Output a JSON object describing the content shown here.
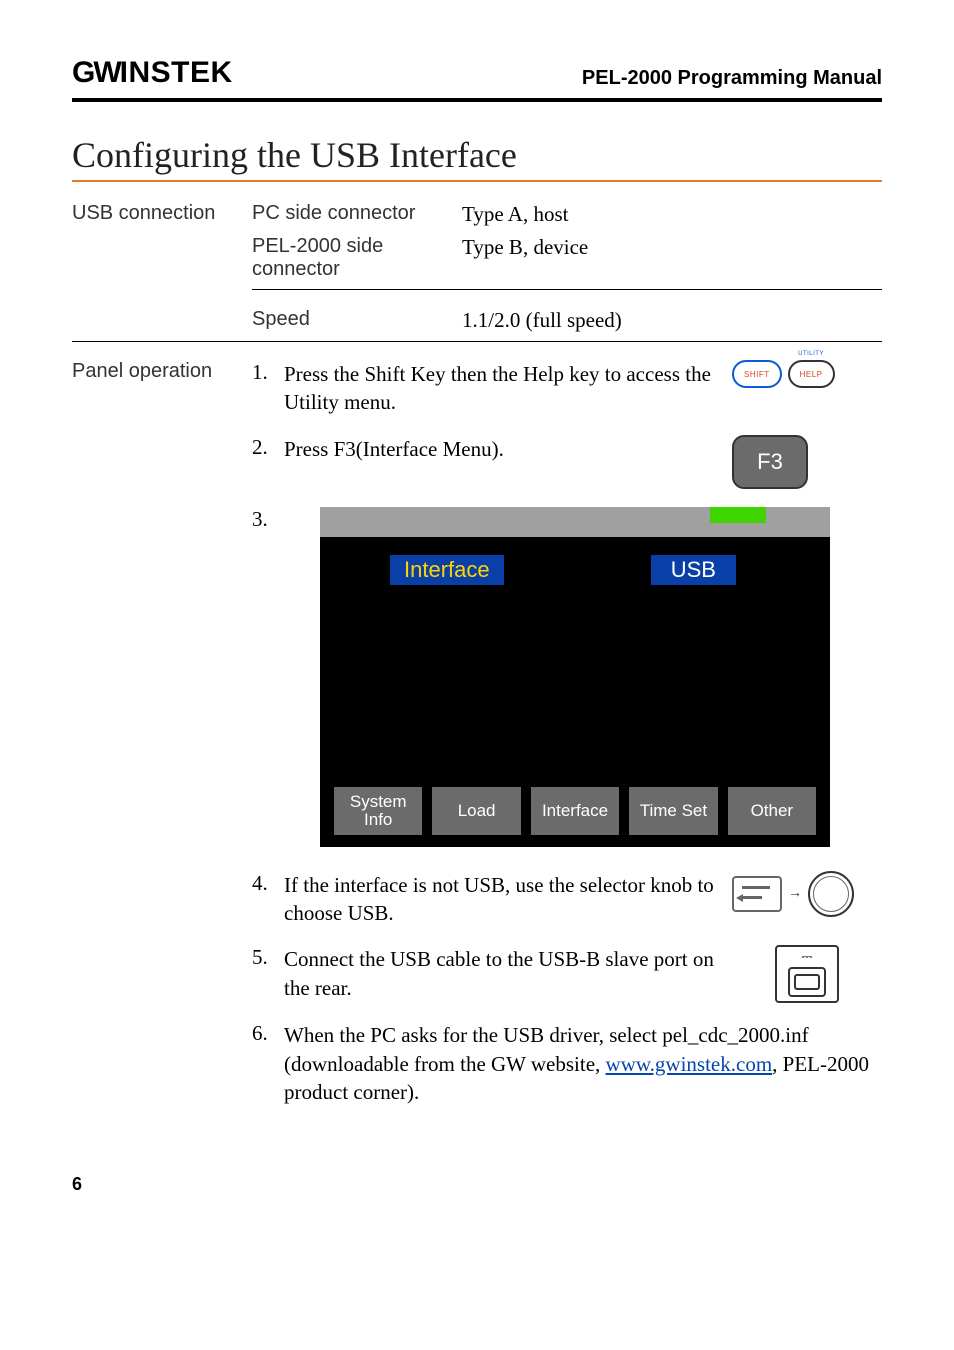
{
  "header": {
    "brand": "GWINSTEK",
    "doc_title": "PEL-2000 Programming Manual"
  },
  "section_title": "Configuring the USB Interface",
  "usb_connection": {
    "label": "USB connection",
    "rows": [
      {
        "a": "PC side connector",
        "b": "Type A, host"
      },
      {
        "a": "PEL-2000 side connector",
        "b": "Type B, device"
      },
      {
        "a": "Speed",
        "b": "1.1/2.0 (full speed)"
      }
    ]
  },
  "panel_operation": {
    "label": "Panel operation",
    "steps": {
      "s1": "Press the Shift Key then the Help key to access the Utility menu.",
      "s2": "Press F3(Interface Menu).",
      "s4": "If the interface is not USB, use the selector knob to choose USB.",
      "s5": "Connect the USB cable to the USB-B slave port on the rear.",
      "s6_a": "When the PC asks for the USB driver, select pel_cdc_2000.inf (downloadable from the GW website, ",
      "s6_link": "www.gwinstek.com",
      "s6_b": ", PEL-2000 product corner)."
    },
    "keys": {
      "shift": "SHIFT",
      "help": "HELP",
      "help_top": "UTILITY",
      "f3": "F3"
    },
    "screen": {
      "field_label": "Interface",
      "field_value": "USB",
      "softkeys": [
        "System\nInfo",
        "Load",
        "Interface",
        "Time Set",
        "Other"
      ]
    }
  },
  "page_number": "6"
}
